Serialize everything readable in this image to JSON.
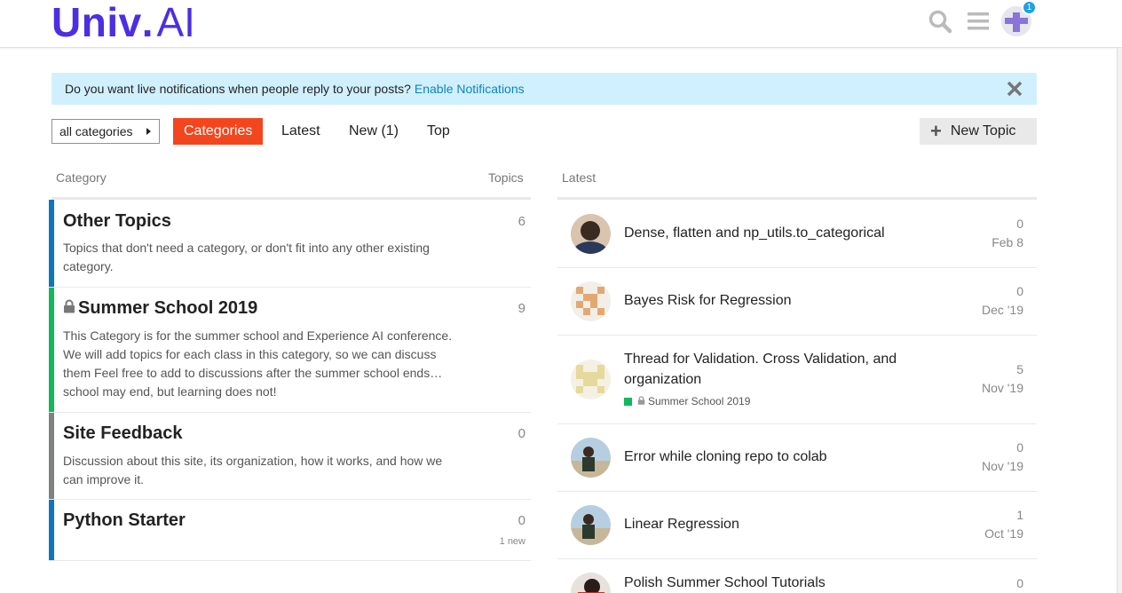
{
  "header": {
    "logo_main": "Univ",
    "logo_dot": ".",
    "logo_ai": "AI",
    "notification_count": "1",
    "brand_color": "#4c2ee3"
  },
  "banner": {
    "text": "Do you want live notifications when people reply to your posts?",
    "link": "Enable Notifications"
  },
  "nav": {
    "category_dropdown": "all categories",
    "tabs": [
      {
        "label": "Categories",
        "active": true
      },
      {
        "label": "Latest",
        "active": false
      },
      {
        "label": "New (1)",
        "active": false
      },
      {
        "label": "Top",
        "active": false
      }
    ],
    "new_topic": "New Topic"
  },
  "categories": {
    "col_category": "Category",
    "col_topics": "Topics",
    "items": [
      {
        "name": "Other Topics",
        "desc": "Topics that don't need a category, or don't fit into any other existing category.",
        "count": "6",
        "color": "#0e76bd",
        "locked": false,
        "new": ""
      },
      {
        "name": "Summer School 2019",
        "desc": "This Category is for the summer school and Experience AI conference. We will add topics for each class in this category, so we can discuss them Feel free to add to discussions after the summer school ends…school may end, but learning does not!",
        "count": "9",
        "color": "#12b85a",
        "locked": true,
        "new": ""
      },
      {
        "name": "Site Feedback",
        "desc": "Discussion about this site, its organization, how it works, and how we can improve it.",
        "count": "0",
        "color": "#808281",
        "locked": false,
        "new": ""
      },
      {
        "name": "Python Starter",
        "desc": "",
        "count": "0",
        "color": "#0e76bd",
        "locked": false,
        "new": "1 new"
      }
    ]
  },
  "latest": {
    "col_latest": "Latest",
    "topics": [
      {
        "title": "Dense, flatten and np_utils.to_categorical",
        "replies": "0",
        "date": "Feb 8",
        "category": ""
      },
      {
        "title": "Bayes Risk for Regression",
        "replies": "0",
        "date": "Dec '19",
        "category": ""
      },
      {
        "title": "Thread for Validation. Cross Validation, and organization",
        "replies": "5",
        "date": "Nov '19",
        "category": "Summer School 2019"
      },
      {
        "title": "Error while cloning repo to colab",
        "replies": "0",
        "date": "Nov '19",
        "category": ""
      },
      {
        "title": "Linear Regression",
        "replies": "1",
        "date": "Oct '19",
        "category": ""
      },
      {
        "title": "Polish Summer School Tutorials",
        "replies": "0",
        "date": "",
        "category": ""
      }
    ]
  }
}
